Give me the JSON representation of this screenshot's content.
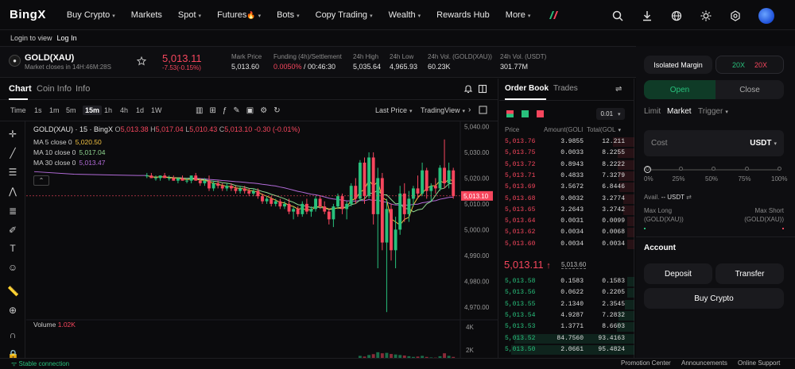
{
  "nav": {
    "logo": "BingX",
    "items": [
      "Buy Crypto",
      "Markets",
      "Spot",
      "Futures",
      "Bots",
      "Copy Trading",
      "Wealth",
      "Rewards Hub",
      "More"
    ],
    "carets": [
      true,
      false,
      true,
      true,
      true,
      true,
      true,
      false,
      true
    ],
    "fire_icon": "fire-icon"
  },
  "subnav": {
    "login_to_view": "Login to view",
    "log_in": "Log In"
  },
  "ticker": {
    "symbol": "GOLD(XAU)",
    "closes_label": "Market closes in",
    "closes_value": "14H:46M:28S",
    "price": "5,013.11",
    "change": "-7.53(-0.15%)",
    "stats": [
      {
        "label": "Mark Price",
        "value": "5,013.60",
        "color": "#e6e6e6"
      },
      {
        "label": "Funding (4h)/Settlement",
        "value": "0.0050%",
        "value2": " / 00:46:30",
        "color": "#f6465d"
      },
      {
        "label": "24h High",
        "value": "5,035.64",
        "color": "#e6e6e6"
      },
      {
        "label": "24h Low",
        "value": "4,965.93",
        "color": "#e6e6e6"
      },
      {
        "label": "24h Vol. (GOLD(XAU))",
        "value": "60.23K",
        "color": "#e6e6e6"
      },
      {
        "label": "24h Vol. (USDT)",
        "value": "301.77M",
        "color": "#e6e6e6"
      }
    ]
  },
  "chart_tabs": [
    "Chart",
    "Coin Info",
    "Info"
  ],
  "toolbar": {
    "timeframes": [
      "Time",
      "1s",
      "1m",
      "5m",
      "15m",
      "1h",
      "4h",
      "1d",
      "1W"
    ],
    "active": "15m",
    "last_price": "Last Price",
    "tradingview": "TradingView"
  },
  "legend": {
    "title": "GOLD(XAU) · 15 · BingX",
    "o_label": "O",
    "o": "5,013.38",
    "h_label": "H",
    "h": "5,017.04",
    "l_label": "L",
    "l": "5,010.43",
    "c_label": "C",
    "c": "5,013.10",
    "chg": "-0.30 (-0.01%)",
    "ma": [
      {
        "label": "MA 5 close 0",
        "value": "5,020.50",
        "color": "#f0c040"
      },
      {
        "label": "MA 10 close 0",
        "value": "5,017.04",
        "color": "#8fd68f"
      },
      {
        "label": "MA 30 close 0",
        "value": "5,013.47",
        "color": "#b26bd8"
      }
    ],
    "volume_label": "Volume",
    "volume_value": "1.02K"
  },
  "price_axis": {
    "ticks": [
      "5,040.00",
      "5,030.00",
      "5,020.00",
      "5,010.00",
      "5,000.00",
      "4,990.00",
      "4,980.00",
      "4,970.00"
    ],
    "current": "5,013.10",
    "vol_ticks": [
      "4K",
      "2K"
    ]
  },
  "orderbook": {
    "tabs": [
      "Order Book",
      "Trades"
    ],
    "precision": "0.01",
    "headers": [
      "Price",
      "Amount(GOLI",
      "Total(GOL"
    ],
    "asks": [
      [
        "5,013.76",
        "3.9855",
        "12.211"
      ],
      [
        "5,013.75",
        "0.0033",
        "8.2255"
      ],
      [
        "5,013.72",
        "0.8943",
        "8.2222"
      ],
      [
        "5,013.71",
        "0.4833",
        "7.3279"
      ],
      [
        "5,013.69",
        "3.5672",
        "6.8446"
      ],
      [
        "5,013.68",
        "0.0032",
        "3.2774"
      ],
      [
        "5,013.65",
        "3.2643",
        "3.2742"
      ],
      [
        "5,013.64",
        "0.0031",
        "0.0099"
      ],
      [
        "5,013.62",
        "0.0034",
        "0.0068"
      ],
      [
        "5,013.60",
        "0.0034",
        "0.0034"
      ]
    ],
    "mid_price": "5,013.11",
    "mid_mark": "5,013.60",
    "bids": [
      [
        "5,013.58",
        "0.1583",
        "0.1583"
      ],
      [
        "5,013.56",
        "0.0622",
        "0.2205"
      ],
      [
        "5,013.55",
        "2.1340",
        "2.3545"
      ],
      [
        "5,013.54",
        "4.9287",
        "7.2832"
      ],
      [
        "5,013.53",
        "1.3771",
        "8.6603"
      ],
      [
        "5,013.52",
        "84.7560",
        "93.4163"
      ],
      [
        "5,013.50",
        "2.0661",
        "95.4824"
      ]
    ]
  },
  "order_form": {
    "isolated": "Isolated Margin",
    "lev_long": "20X",
    "lev_short": "20X",
    "open": "Open",
    "close": "Close",
    "types": [
      "Limit",
      "Market",
      "Trigger"
    ],
    "active_type": "Market",
    "cost_placeholder": "Cost",
    "cost_unit": "USDT",
    "slider_marks": [
      "0%",
      "25%",
      "50%",
      "75%",
      "100%"
    ],
    "avail_label": "Avail.",
    "avail_value": "-- USDT",
    "max_long": "Max Long",
    "max_short": "Max Short",
    "max_long_unit": "(GOLD(XAU))",
    "max_short_unit": "(GOLD(XAU))",
    "dash": "--",
    "account": "Account",
    "deposit": "Deposit",
    "transfer": "Transfer",
    "buy_crypto": "Buy Crypto"
  },
  "footer": {
    "status": "Stable connection",
    "links": [
      "Promotion Center",
      "Announcements",
      "Online Support"
    ]
  },
  "colors": {
    "up": "#28c07c",
    "down": "#f6465d",
    "bg": "#0b0b0d"
  },
  "chart_data": {
    "type": "candlestick",
    "ylim": [
      4965,
      5042
    ],
    "candles": [
      [
        5021,
        5022,
        5020,
        5021
      ],
      [
        5021,
        5022,
        5020,
        5020
      ],
      [
        5020,
        5021,
        5019,
        5020
      ],
      [
        5020,
        5021,
        5019,
        5021
      ],
      [
        5021,
        5022,
        5020,
        5020
      ],
      [
        5020,
        5021,
        5019,
        5020
      ],
      [
        5020,
        5021,
        5019,
        5019
      ],
      [
        5019,
        5020,
        5018,
        5020
      ],
      [
        5020,
        5021,
        5019,
        5019
      ],
      [
        5019,
        5020,
        5018,
        5019
      ],
      [
        5019,
        5021,
        5018,
        5021
      ],
      [
        5021,
        5022,
        5019,
        5019
      ],
      [
        5019,
        5020,
        5017,
        5018
      ],
      [
        5018,
        5020,
        5017,
        5019
      ],
      [
        5019,
        5021,
        5015,
        5016
      ],
      [
        5016,
        5019,
        5015,
        5018
      ],
      [
        5018,
        5019,
        5016,
        5017
      ],
      [
        5017,
        5018,
        5015,
        5016
      ],
      [
        5016,
        5018,
        5015,
        5017
      ],
      [
        5017,
        5018,
        5015,
        5016
      ],
      [
        5016,
        5017,
        5014,
        5015
      ],
      [
        5015,
        5017,
        5014,
        5016
      ],
      [
        5016,
        5017,
        5014,
        5015
      ],
      [
        5015,
        5016,
        5013,
        5014
      ],
      [
        5014,
        5016,
        5013,
        5015
      ],
      [
        5015,
        5016,
        5012,
        5013
      ],
      [
        5013,
        5014,
        5010,
        5011
      ],
      [
        5011,
        5013,
        5010,
        5012
      ],
      [
        5012,
        5013,
        5009,
        5010
      ],
      [
        5010,
        5012,
        5009,
        5011
      ],
      [
        5011,
        5012,
        5008,
        5009
      ],
      [
        5009,
        5011,
        5008,
        5010
      ],
      [
        5010,
        5012,
        5006,
        5007
      ],
      [
        5007,
        5009,
        5004,
        5008
      ],
      [
        5008,
        5009,
        5005,
        5006
      ],
      [
        5006,
        5011,
        5005,
        5010
      ],
      [
        5010,
        5012,
        5006,
        5007
      ],
      [
        5007,
        5009,
        5005,
        5008
      ],
      [
        5008,
        5013,
        5007,
        5012
      ],
      [
        5012,
        5013,
        5008,
        5009
      ],
      [
        5009,
        5011,
        5006,
        5007
      ],
      [
        5007,
        5008,
        5002,
        5004
      ],
      [
        5004,
        5010,
        5001,
        5009
      ],
      [
        5009,
        5014,
        5008,
        5013
      ],
      [
        5013,
        5014,
        5006,
        5008
      ],
      [
        5008,
        5011,
        5004,
        5010
      ],
      [
        5010,
        5018,
        5009,
        5017
      ],
      [
        5017,
        5020,
        5010,
        5012
      ],
      [
        5012,
        5027,
        5011,
        5026
      ],
      [
        5026,
        5028,
        5010,
        5013
      ],
      [
        5013,
        5030,
        5012,
        5028
      ],
      [
        5028,
        5030,
        5002,
        5006
      ],
      [
        5006,
        5024,
        4985,
        5020
      ],
      [
        5020,
        5022,
        4992,
        4995
      ],
      [
        4995,
        5012,
        4968,
        5008
      ],
      [
        5008,
        5010,
        4988,
        4992
      ],
      [
        4992,
        5005,
        4985,
        5000
      ],
      [
        5000,
        5017,
        4998,
        5014
      ],
      [
        5014,
        5018,
        5003,
        5006
      ],
      [
        5006,
        5015,
        5003,
        5012
      ],
      [
        5012,
        5017,
        5009,
        5016
      ],
      [
        5016,
        5021,
        5012,
        5014
      ],
      [
        5014,
        5026,
        5013,
        5023
      ],
      [
        5023,
        5024,
        5012,
        5015
      ],
      [
        5015,
        5018,
        5011,
        5017
      ],
      [
        5017,
        5020,
        5014,
        5016
      ],
      [
        5016,
        5025,
        5015,
        5024
      ],
      [
        5024,
        5035,
        5016,
        5018
      ],
      [
        5018,
        5026,
        5016,
        5023
      ],
      [
        5023,
        5024,
        5012,
        5013
      ]
    ],
    "ma5_color": "#f0c040",
    "ma10_color": "#8fd68f",
    "ma30_color": "#b26bd8",
    "volumes": [
      120,
      90,
      80,
      100,
      110,
      95,
      85,
      105,
      90,
      100,
      130,
      110,
      95,
      100,
      180,
      120,
      110,
      100,
      105,
      95,
      90,
      100,
      110,
      95,
      90,
      105,
      140,
      110,
      120,
      100,
      115,
      105,
      160,
      150,
      110,
      190,
      140,
      120,
      170,
      140,
      120,
      200,
      230,
      220,
      180,
      200,
      260,
      240,
      600,
      520,
      700,
      800,
      1020,
      900,
      950,
      820,
      760,
      700,
      640,
      560,
      480,
      520,
      600,
      480,
      420,
      400,
      560,
      900,
      600,
      480
    ]
  }
}
